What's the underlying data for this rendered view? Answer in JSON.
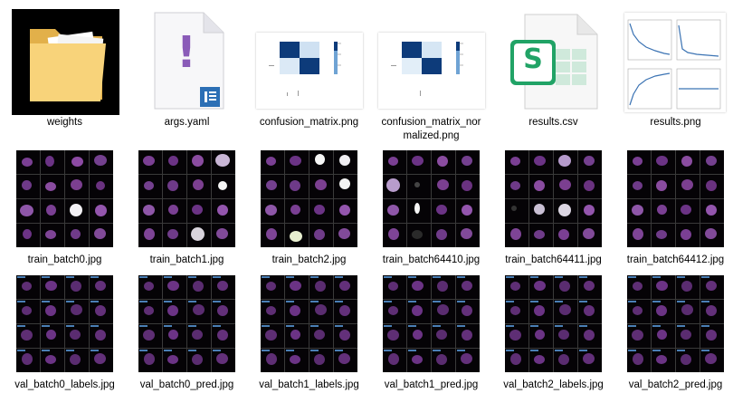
{
  "files": {
    "row1": [
      {
        "name": "weights",
        "icon": "folder-icon"
      },
      {
        "name": "args.yaml",
        "icon": "yaml-file-icon"
      },
      {
        "name": "confusion_matrix.png",
        "icon": "image-thumbnail"
      },
      {
        "name": "confusion_matrix_nor\nmalized.png",
        "icon": "image-thumbnail"
      },
      {
        "name": "results.csv",
        "icon": "spreadsheet-icon"
      },
      {
        "name": "results.png",
        "icon": "image-thumbnail"
      }
    ],
    "row2": [
      {
        "name": "train_batch0.jpg"
      },
      {
        "name": "train_batch1.jpg"
      },
      {
        "name": "train_batch2.jpg"
      },
      {
        "name": "train_batch64410.jpg"
      },
      {
        "name": "train_batch64411.jpg"
      },
      {
        "name": "train_batch64412.jpg"
      }
    ],
    "row3": [
      {
        "name": "val_batch0_labels.jpg"
      },
      {
        "name": "val_batch0_pred.jpg"
      },
      {
        "name": "val_batch1_labels.jpg"
      },
      {
        "name": "val_batch1_pred.jpg"
      },
      {
        "name": "val_batch2_labels.jpg"
      },
      {
        "name": "val_batch2_pred.jpg"
      }
    ]
  },
  "icons": {
    "yaml_glyph": "!",
    "csv_glyph": "S"
  },
  "colors": {
    "folder": "#f5cc6a",
    "folder_selected_bg": "#000000",
    "yaml_accent": "#8a5bb8",
    "csv_green": "#21a366",
    "matrix_dark": "#0d3b7a",
    "cell_purple": "#7a3f93"
  }
}
